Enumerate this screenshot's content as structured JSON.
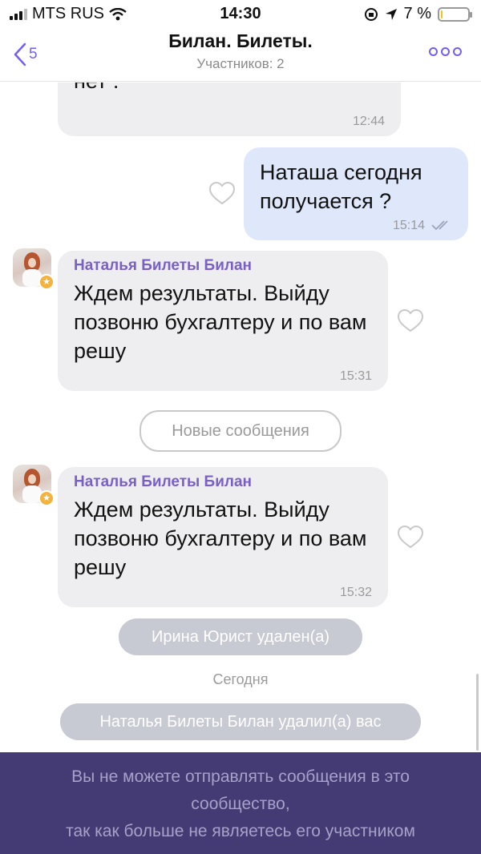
{
  "status_bar": {
    "carrier": "MTS RUS",
    "time": "14:30",
    "battery_text": "7 %",
    "battery_level": 0.07
  },
  "header": {
    "back_count": "5",
    "title": "Билан. Билеты.",
    "subtitle": "Участников: 2",
    "more_icon": "more-dots-icon"
  },
  "messages": [
    {
      "type": "incoming",
      "text": "нет .",
      "time": "12:44"
    },
    {
      "type": "outgoing",
      "text": "Наташа сегодня получается ?",
      "time": "15:14",
      "status_icon": "double-check-icon"
    },
    {
      "type": "incoming",
      "sender": "Наталья Билеты Билан",
      "text": "Ждем результаты. Выйду позвоню бухгалтеру и по вам решу",
      "time": "15:31"
    },
    {
      "type": "incoming",
      "sender": "Наталья Билеты Билан",
      "text": "Ждем результаты. Выйду позвоню бухгалтеру и по вам решу",
      "time": "15:32"
    }
  ],
  "new_messages_label": "Новые сообщения",
  "system": {
    "removed_notice": "Ирина Юрист удален(а)",
    "date_divider": "Сегодня",
    "removed_you_notice": "Наталья Билеты Билан удалил(а) вас"
  },
  "banner": {
    "line1": "Вы не можете отправлять сообщения в это",
    "line2": "сообщество,",
    "line3": "так как больше не являетесь его участником"
  },
  "colors": {
    "accent": "#7360f2",
    "incoming_bubble": "#eeeef0",
    "outgoing_bubble": "#dfe7fb",
    "banner_bg": "#453b74"
  }
}
